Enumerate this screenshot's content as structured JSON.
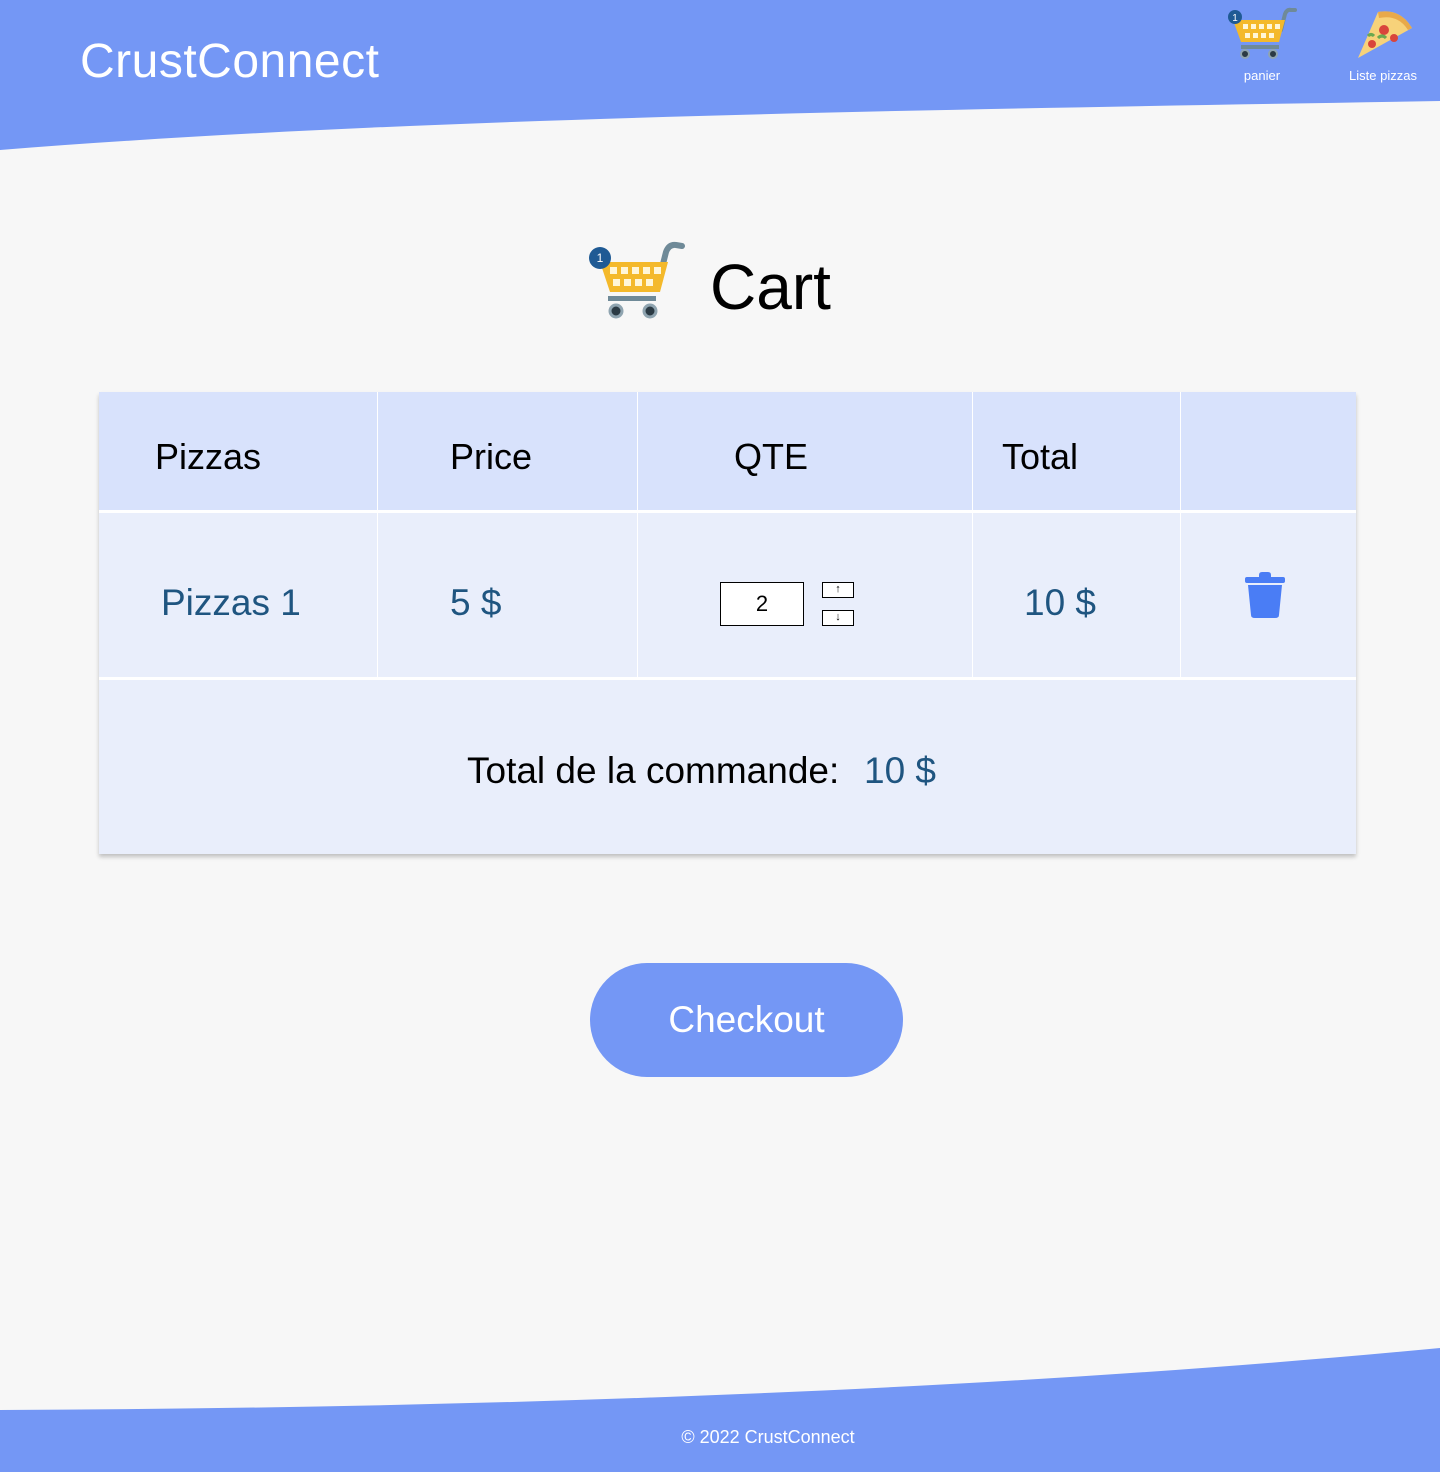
{
  "header": {
    "brand": "CrustConnect",
    "nav": {
      "cart_label": "panier",
      "cart_badge": "1",
      "pizzas_label": "Liste pizzas"
    }
  },
  "page_title": {
    "title": "Cart",
    "badge": "1"
  },
  "table": {
    "headers": [
      "Pizzas",
      "Price",
      "QTE",
      "Total",
      ""
    ],
    "rows": [
      {
        "name": "Pizzas 1",
        "price": "5 $",
        "qty": "2",
        "total": "10 $"
      }
    ],
    "order_total_label": "Total de la commande:",
    "order_total_value": "10 $"
  },
  "checkout_label": "Checkout",
  "footer": {
    "text": "© 2022 CrustConnect"
  },
  "colors": {
    "brand_blue": "#7497f5",
    "header_row": "#d8e2fc",
    "body_row": "#e9eefb",
    "value_text": "#1f5580",
    "trash": "#4a7df5"
  },
  "icons": {
    "cart": "shopping-cart-icon",
    "pizza": "pizza-slice-icon",
    "trash": "trash-icon",
    "step_up": "arrow-up-icon",
    "step_down": "arrow-down-icon"
  }
}
